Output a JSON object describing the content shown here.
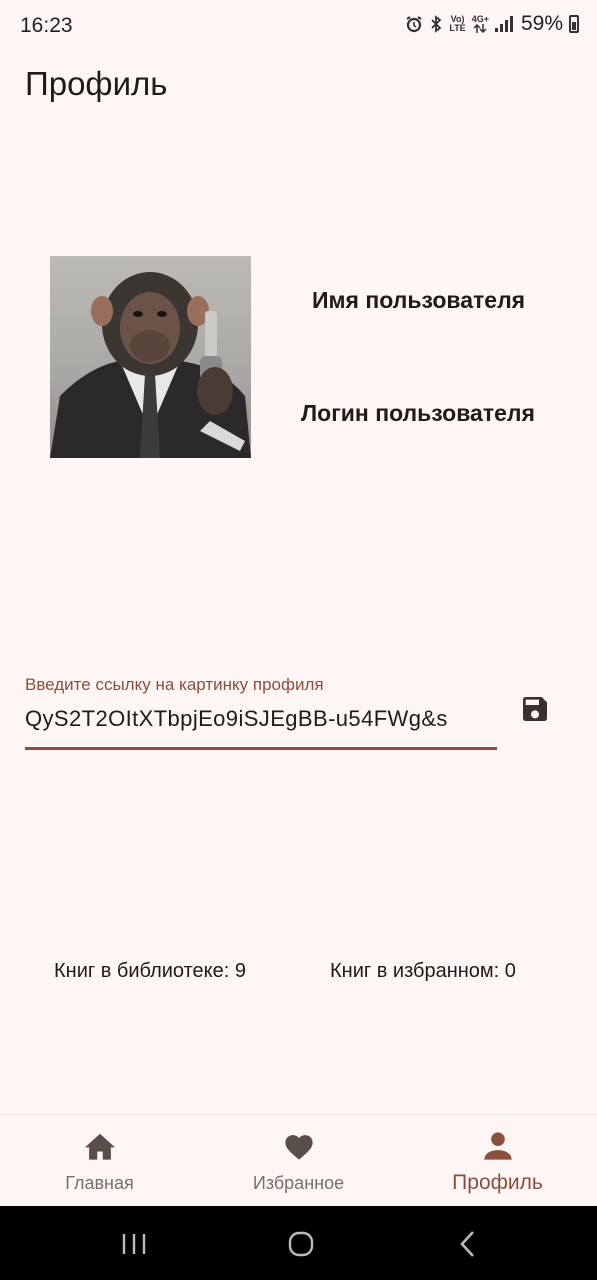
{
  "status_bar": {
    "time": "16:23",
    "network_top": "Vo)",
    "network_bottom": "LTE",
    "net_type": "4G+",
    "battery_percent": "59%"
  },
  "page": {
    "title": "Профиль"
  },
  "profile": {
    "avatar_icon": "profile-photo",
    "name": "Имя пользователя",
    "login": "Логин пользователя"
  },
  "image_url_input": {
    "label": "Введите ссылку на картинку профиля",
    "value": "QyS2T2OItXTbpjEo9iSJEgBB-u54FWg&s"
  },
  "save_icon": "save-icon",
  "stats": {
    "library": "Книг в библиотеке: 9",
    "favorites": "Книг в избранном: 0"
  },
  "bottom_nav": {
    "items": [
      {
        "label": "Главная",
        "icon": "home-icon",
        "active": false
      },
      {
        "label": "Избранное",
        "icon": "heart-icon",
        "active": false
      },
      {
        "label": "Профиль",
        "icon": "person-icon",
        "active": true
      }
    ]
  },
  "colors": {
    "background": "#fdf6f4",
    "accent": "#8a4f3d",
    "inactive": "#7a6e6b"
  }
}
